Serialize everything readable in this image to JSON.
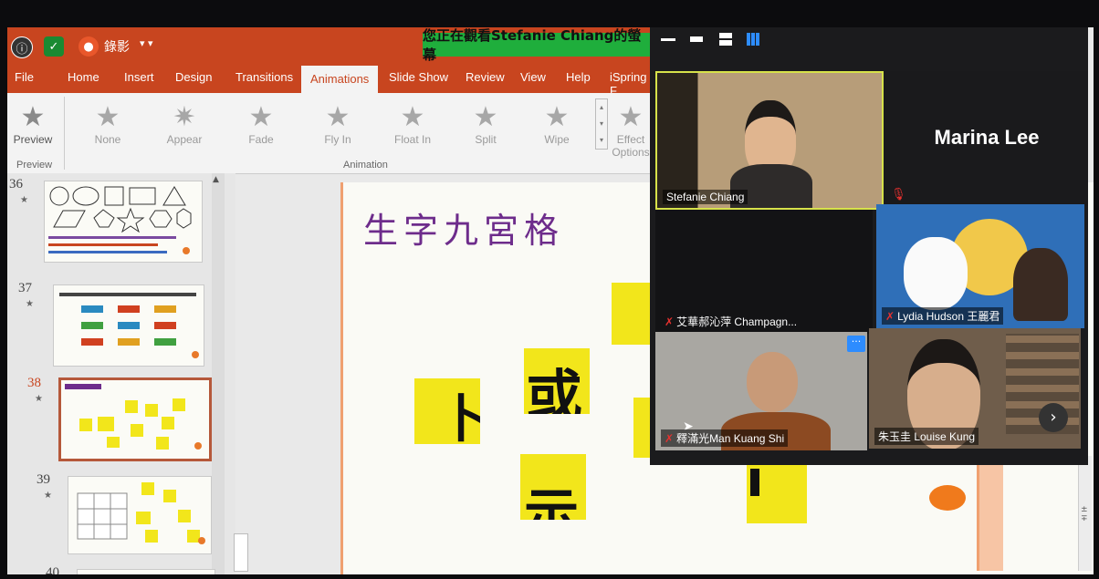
{
  "share_banner": "您正在觀看Stefanie Chiang的螢幕",
  "quick_access": {
    "app_title": "錄影"
  },
  "tabs": [
    "File",
    "Home",
    "Insert",
    "Design",
    "Transitions",
    "Animations",
    "Slide Show",
    "Review",
    "View",
    "Help",
    "iSpring F"
  ],
  "active_tab": "Animations",
  "ribbon": {
    "preview": "Preview",
    "effects": [
      "None",
      "Appear",
      "Fade",
      "Fly In",
      "Float In",
      "Split",
      "Wipe"
    ],
    "effect_options": [
      "Effect",
      "Options"
    ],
    "group_preview": "Preview",
    "group_animation": "Animation"
  },
  "thumbnails": [
    {
      "num": "36"
    },
    {
      "num": "37"
    },
    {
      "num": "38"
    },
    {
      "num": "39"
    },
    {
      "num": "40"
    }
  ],
  "slide": {
    "title": "生字九宮格",
    "glyphs": [
      "卜",
      "或",
      "示"
    ]
  },
  "zoom": {
    "participants": [
      {
        "name": "Stefanie Chiang"
      },
      {
        "name": "Marina Lee"
      },
      {
        "name": "艾華郝沁萍 Champagn..."
      },
      {
        "name": "Lydia Hudson 王麗君"
      },
      {
        "name": "釋滿光Man Kuang Shi"
      },
      {
        "name": "朱玉圭 Louise Kung"
      }
    ],
    "more_button": "···"
  },
  "colors": {
    "ppt_orange": "#c8451f",
    "slide_title": "#6d2c8b",
    "card_yellow": "#f2e61b",
    "zoom_green": "#1fae3c"
  }
}
